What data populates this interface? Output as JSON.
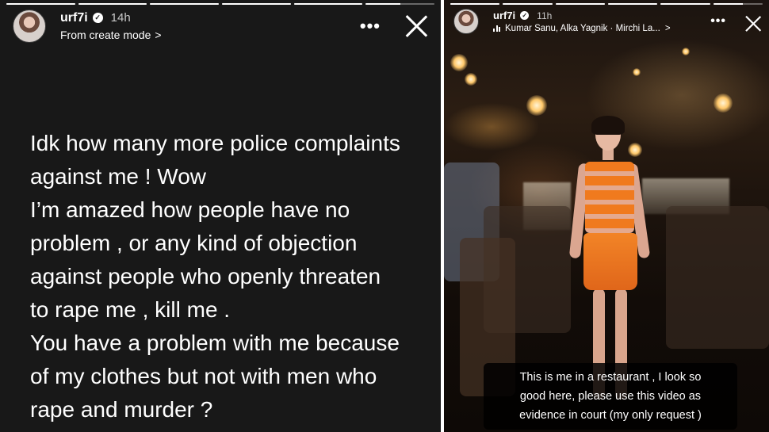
{
  "left_story": {
    "username": "urf7i",
    "verified_icon": "verified-check-icon",
    "time": "14h",
    "subtitle": "From create mode",
    "subtitle_chevron": ">",
    "more_label": "•••",
    "progress": [
      1,
      1,
      1,
      1,
      1,
      0.5
    ],
    "text": "Idk how many more police complaints\nagainst me ! Wow\nI’m amazed how people have no\nproblem , or any kind of objection\nagainst people who openly threaten\nto rape me , kill me .\nYou have a problem with me because\nof my clothes but not with men who\nrape and murder ?"
  },
  "right_story": {
    "username": "urf7i",
    "verified_icon": "verified-check-icon",
    "time": "11h",
    "music": "Kumar Sanu, Alka Yagnik · Mirchi La...",
    "music_chevron": ">",
    "more_label": "•••",
    "progress": [
      1,
      1,
      1,
      1,
      1,
      0.6
    ],
    "caption": "This is me in a restaurant , I look so\ngood here, please use this video as\nevidence in court (my only request )"
  },
  "colors": {
    "left_background": "#181818",
    "outfit_orange": "#f07a1e",
    "text": "#ffffff"
  }
}
